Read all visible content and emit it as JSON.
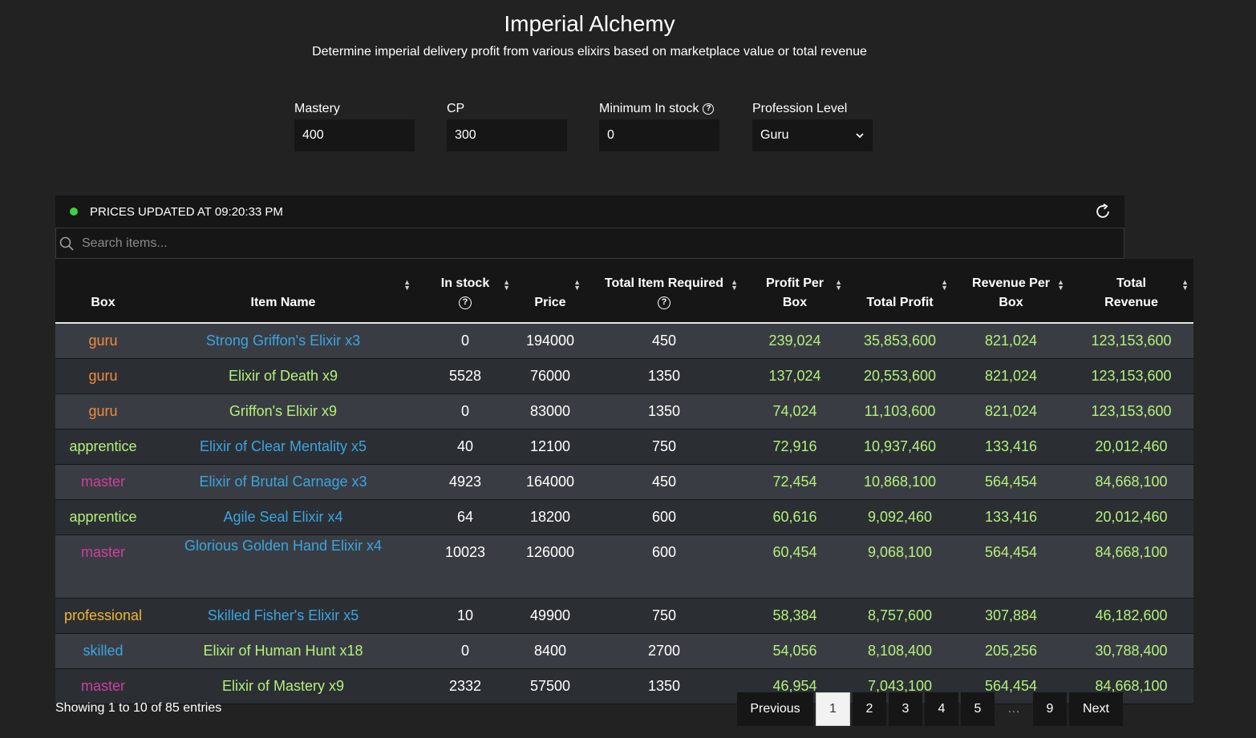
{
  "header": {
    "title": "Imperial Alchemy",
    "subtitle": "Determine imperial delivery profit from various elixirs based on marketplace value or total revenue"
  },
  "filters": {
    "mastery": {
      "label": "Mastery",
      "value": "400"
    },
    "cp": {
      "label": "CP",
      "value": "300"
    },
    "min_stock": {
      "label": "Minimum In stock",
      "value": "0"
    },
    "profession": {
      "label": "Profession Level",
      "value": "Guru"
    }
  },
  "status": {
    "text": "PRICES UPDATED AT 09:20:33 PM",
    "dot_color": "#3ed33e"
  },
  "search": {
    "placeholder": "Search items..."
  },
  "table": {
    "columns": [
      {
        "line1": "",
        "line2": "Box",
        "help": false,
        "sortable": false
      },
      {
        "line1": "",
        "line2": "Item Name",
        "help": false,
        "sortable": true
      },
      {
        "line1": "In stock",
        "line2": "",
        "help": true,
        "sortable": true
      },
      {
        "line1": "",
        "line2": "Price",
        "help": false,
        "sortable": true
      },
      {
        "line1": "Total Item Required",
        "line2": "",
        "help": true,
        "sortable": true
      },
      {
        "line1": "Profit Per",
        "line2": "Box",
        "help": false,
        "sortable": true
      },
      {
        "line1": "",
        "line2": "Total Profit",
        "help": false,
        "sortable": true
      },
      {
        "line1": "Revenue Per",
        "line2": "Box",
        "help": false,
        "sortable": true
      },
      {
        "line1": "Total",
        "line2": "Revenue",
        "help": false,
        "sortable": true
      }
    ],
    "rows": [
      {
        "box": "guru",
        "box_color": "orange",
        "item": "Strong Griffon's Elixir x3",
        "item_color": "blue",
        "stock": "0",
        "price": "194000",
        "required": "450",
        "profit_per_box": "239,024",
        "total_profit": "35,853,600",
        "revenue_per_box": "821,024",
        "total_revenue": "123,153,600"
      },
      {
        "box": "guru",
        "box_color": "orange",
        "item": "Elixir of Death x9",
        "item_color": "green",
        "stock": "5528",
        "price": "76000",
        "required": "1350",
        "profit_per_box": "137,024",
        "total_profit": "20,553,600",
        "revenue_per_box": "821,024",
        "total_revenue": "123,153,600"
      },
      {
        "box": "guru",
        "box_color": "orange",
        "item": "Griffon's Elixir x9",
        "item_color": "green",
        "stock": "0",
        "price": "83000",
        "required": "1350",
        "profit_per_box": "74,024",
        "total_profit": "11,103,600",
        "revenue_per_box": "821,024",
        "total_revenue": "123,153,600"
      },
      {
        "box": "apprentice",
        "box_color": "green",
        "item": "Elixir of Clear Mentality x5",
        "item_color": "blue",
        "stock": "40",
        "price": "12100",
        "required": "750",
        "profit_per_box": "72,916",
        "total_profit": "10,937,460",
        "revenue_per_box": "133,416",
        "total_revenue": "20,012,460"
      },
      {
        "box": "master",
        "box_color": "pink",
        "item": "Elixir of Brutal Carnage x3",
        "item_color": "blue",
        "stock": "4923",
        "price": "164000",
        "required": "450",
        "profit_per_box": "72,454",
        "total_profit": "10,868,100",
        "revenue_per_box": "564,454",
        "total_revenue": "84,668,100"
      },
      {
        "box": "apprentice",
        "box_color": "green",
        "item": "Agile Seal Elixir x4",
        "item_color": "blue",
        "stock": "64",
        "price": "18200",
        "required": "600",
        "profit_per_box": "60,616",
        "total_profit": "9,092,460",
        "revenue_per_box": "133,416",
        "total_revenue": "20,012,460"
      },
      {
        "box": "master",
        "box_color": "pink",
        "item": "Glorious Golden Hand Elixir x4",
        "item_color": "blue",
        "stock": "10023",
        "price": "126000",
        "required": "600",
        "profit_per_box": "60,454",
        "total_profit": "9,068,100",
        "revenue_per_box": "564,454",
        "total_revenue": "84,668,100"
      },
      {
        "box": "professional",
        "box_color": "gold",
        "item": "Skilled Fisher's Elixir x5",
        "item_color": "blue",
        "stock": "10",
        "price": "49900",
        "required": "750",
        "profit_per_box": "58,384",
        "total_profit": "8,757,600",
        "revenue_per_box": "307,884",
        "total_revenue": "46,182,600"
      },
      {
        "box": "skilled",
        "box_color": "skilled",
        "item": "Elixir of Human Hunt x18",
        "item_color": "green",
        "stock": "0",
        "price": "8400",
        "required": "2700",
        "profit_per_box": "54,056",
        "total_profit": "8,108,400",
        "revenue_per_box": "205,256",
        "total_revenue": "30,788,400"
      },
      {
        "box": "master",
        "box_color": "pink",
        "item": "Elixir of Mastery x9",
        "item_color": "green",
        "stock": "2332",
        "price": "57500",
        "required": "1350",
        "profit_per_box": "46,954",
        "total_profit": "7,043,100",
        "revenue_per_box": "564,454",
        "total_revenue": "84,668,100"
      }
    ]
  },
  "footer": {
    "showing": "Showing 1 to 10 of 85 entries",
    "pagination": {
      "previous": "Previous",
      "pages": [
        "1",
        "2",
        "3",
        "4",
        "5",
        "…",
        "9"
      ],
      "active": "1",
      "next": "Next"
    }
  },
  "colors": {
    "background": "#222222",
    "panel": "#161616",
    "row_odd": "#393d43",
    "row_even": "#2b2f34",
    "value_green": "#b5f07a",
    "link_blue": "#3aa5e0",
    "guru_orange": "#f08a3c",
    "master_pink": "#cf3f9e",
    "professional_gold": "#f2b632"
  }
}
